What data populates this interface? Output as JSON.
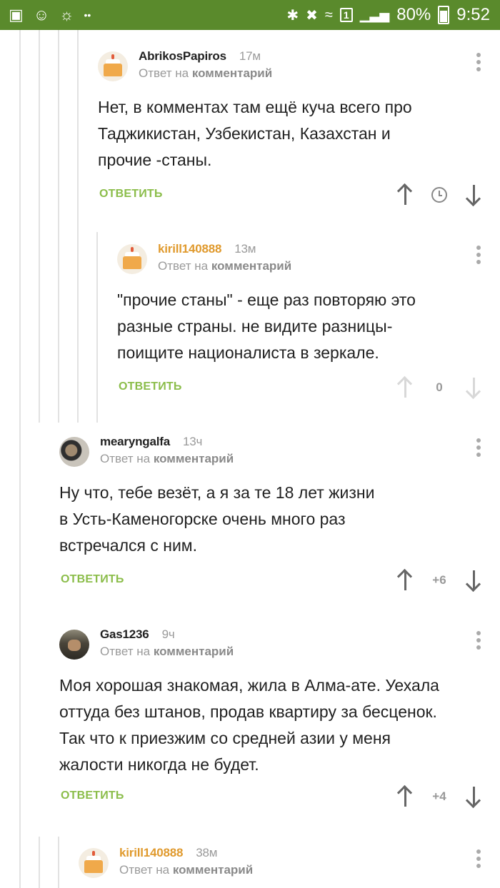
{
  "status_bar": {
    "sim_badge": "1",
    "battery": "80%",
    "time": "9:52"
  },
  "comments": [
    {
      "author": "AbrikosPapiros",
      "time": "17м",
      "reply_prefix": "Ответ на",
      "reply_target": "комментарий",
      "lines": [
        "Нет, в комментах там ещё куча всего про",
        "Таджикистан, Узбекистан, Казахстан и",
        "прочие -станы."
      ],
      "reply_label": "ОТВЕТИТЬ",
      "score": ""
    },
    {
      "author": "kirill140888",
      "time": "13м",
      "reply_prefix": "Ответ на",
      "reply_target": "комментарий",
      "lines": [
        "\"прочие станы\" - еще раз повторяю это",
        "разные страны. не видите разницы-",
        "поищите националиста в зеркале."
      ],
      "reply_label": "ОТВЕТИТЬ",
      "score": "0"
    },
    {
      "author": "mearyngalfa",
      "time": "13ч",
      "reply_prefix": "Ответ на",
      "reply_target": "комментарий",
      "lines": [
        "Ну что, тебе везёт, а я за те 18 лет жизни",
        "в Усть-Каменогорске очень много раз",
        "встречался с ним."
      ],
      "reply_label": "ОТВЕТИТЬ",
      "score": "+6"
    },
    {
      "author": "Gas1236",
      "time": "9ч",
      "reply_prefix": "Ответ на",
      "reply_target": "комментарий",
      "lines": [
        "Моя хорошая знакомая, жила в Алма-ате. Уехала",
        "оттуда без штанов, продав квартиру за бесценок.",
        "Так что к приезжим со средней азии у меня",
        "жалости никогда не будет."
      ],
      "reply_label": "ОТВЕТИТЬ",
      "score": "+4"
    },
    {
      "author": "kirill140888",
      "time": "38м",
      "reply_prefix": "Ответ на",
      "reply_target": "комментарий"
    }
  ],
  "colors": {
    "status_bar": "#5a8a2c",
    "reply_action": "#8bbd4a",
    "author_highlight": "#e09a2e"
  }
}
